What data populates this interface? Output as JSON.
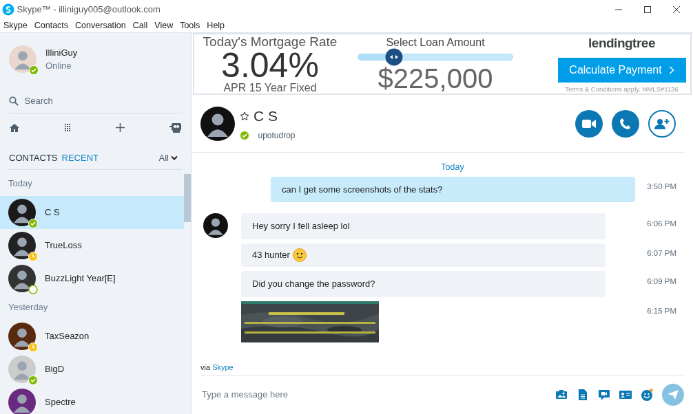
{
  "window": {
    "title": "Skype™ - illiniguy005@outlook.com"
  },
  "menu": [
    "Skype",
    "Contacts",
    "Conversation",
    "Call",
    "View",
    "Tools",
    "Help"
  ],
  "profile": {
    "name": "IlliniGuy",
    "status_text": "Online",
    "presence": {
      "kind": "online"
    }
  },
  "search": {
    "placeholder": "Search"
  },
  "list_tabs": [
    {
      "label": "CONTACTS",
      "selected": false
    },
    {
      "label": "RECENT",
      "selected": true
    }
  ],
  "filter": {
    "label": "All"
  },
  "groups": [
    {
      "label": "Today",
      "contacts": [
        {
          "name": "C S",
          "presence": {
            "kind": "online"
          },
          "selected": true
        },
        {
          "name": "TrueLoss",
          "presence": {
            "kind": "away"
          },
          "selected": false
        },
        {
          "name": "BuzzLight Year[E]",
          "presence": {
            "kind": "offline"
          },
          "selected": false
        }
      ]
    },
    {
      "label": "Yesterday",
      "contacts": [
        {
          "name": "TaxSeazon",
          "presence": {
            "kind": "away"
          },
          "selected": false
        },
        {
          "name": "BigD",
          "presence": {
            "kind": "online"
          },
          "selected": false
        },
        {
          "name": "Spectre",
          "selected": false
        }
      ]
    }
  ],
  "ad": {
    "rate_title": "Today's Mortgage Rate",
    "rate": "3.04%",
    "rate_sub": "APR 15 Year Fixed",
    "slider_title": "Select Loan Amount",
    "slider": {
      "level": 0.23
    },
    "amount": "$225,000",
    "logo": "lendingtree",
    "button": "Calculate Payment",
    "terms": "Terms & Conditions apply. NMLS#1136"
  },
  "conversation": {
    "name": "C S",
    "mood": "upotudrop",
    "presence": {
      "kind": "online"
    },
    "favorite": false
  },
  "day_label": "Today",
  "messages": [
    {
      "kind": "text",
      "outgoing": true,
      "show_avatar": false,
      "text": "can I get some screenshots of the stats?",
      "emoticon": false,
      "time": "3:50 PM"
    },
    {
      "kind": "text",
      "outgoing": false,
      "show_avatar": true,
      "text": "Hey sorry I fell asleep lol",
      "emoticon": false,
      "time": "6:06 PM"
    },
    {
      "kind": "text",
      "outgoing": false,
      "show_avatar": false,
      "text": "43 hunter",
      "emoticon": true,
      "time": "6:07 PM"
    },
    {
      "kind": "text",
      "outgoing": false,
      "show_avatar": false,
      "text": "Did you change the password?",
      "emoticon": false,
      "time": "6:09 PM"
    },
    {
      "outgoing": false,
      "show_avatar": false,
      "time": "6:15 PM"
    }
  ],
  "via": {
    "prefix": "via",
    "link": "Skype"
  },
  "compose": {
    "placeholder": "Type a message here"
  }
}
